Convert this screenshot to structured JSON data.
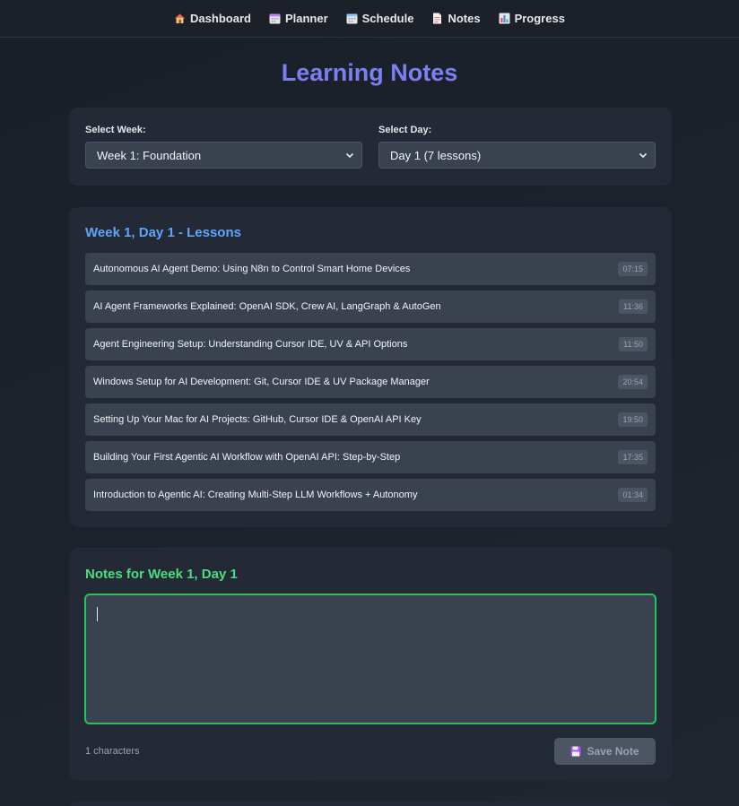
{
  "nav": {
    "items": [
      {
        "label": "Dashboard",
        "icon": "house-icon"
      },
      {
        "label": "Planner",
        "icon": "calendar-icon"
      },
      {
        "label": "Schedule",
        "icon": "calendar-icon"
      },
      {
        "label": "Notes",
        "icon": "document-icon"
      },
      {
        "label": "Progress",
        "icon": "bar-chart-icon"
      }
    ]
  },
  "page": {
    "title": "Learning Notes"
  },
  "selectors": {
    "week_label": "Select Week:",
    "week_value": "Week 1: Foundation",
    "day_label": "Select Day:",
    "day_value": "Day 1 (7 lessons)"
  },
  "lessons": {
    "title": "Week 1, Day 1 - Lessons",
    "items": [
      {
        "title": "Autonomous AI Agent Demo: Using N8n to Control Smart Home Devices",
        "duration": "07:15"
      },
      {
        "title": "AI Agent Frameworks Explained: OpenAI SDK, Crew AI, LangGraph & AutoGen",
        "duration": "11:36"
      },
      {
        "title": "Agent Engineering Setup: Understanding Cursor IDE, UV & API Options",
        "duration": "11:50"
      },
      {
        "title": "Windows Setup for AI Development: Git, Cursor IDE & UV Package Manager",
        "duration": "20:54"
      },
      {
        "title": "Setting Up Your Mac for AI Projects: GitHub, Cursor IDE & OpenAI API Key",
        "duration": "19:50"
      },
      {
        "title": "Building Your First Agentic AI Workflow with OpenAI API: Step-by-Step",
        "duration": "17:35"
      },
      {
        "title": "Introduction to Agentic AI: Creating Multi-Step LLM Workflows + Autonomy",
        "duration": "01:34"
      }
    ]
  },
  "notes": {
    "title": "Notes for Week 1, Day 1",
    "value": "",
    "char_count": "1 characters",
    "save_label": "Save Note",
    "save_icon": "floppy-disk-icon"
  },
  "colors": {
    "accent_title": "#7c7ff0",
    "lessons_title": "#60a5fa",
    "notes_title": "#4ade80",
    "notes_border": "#22c55e"
  }
}
